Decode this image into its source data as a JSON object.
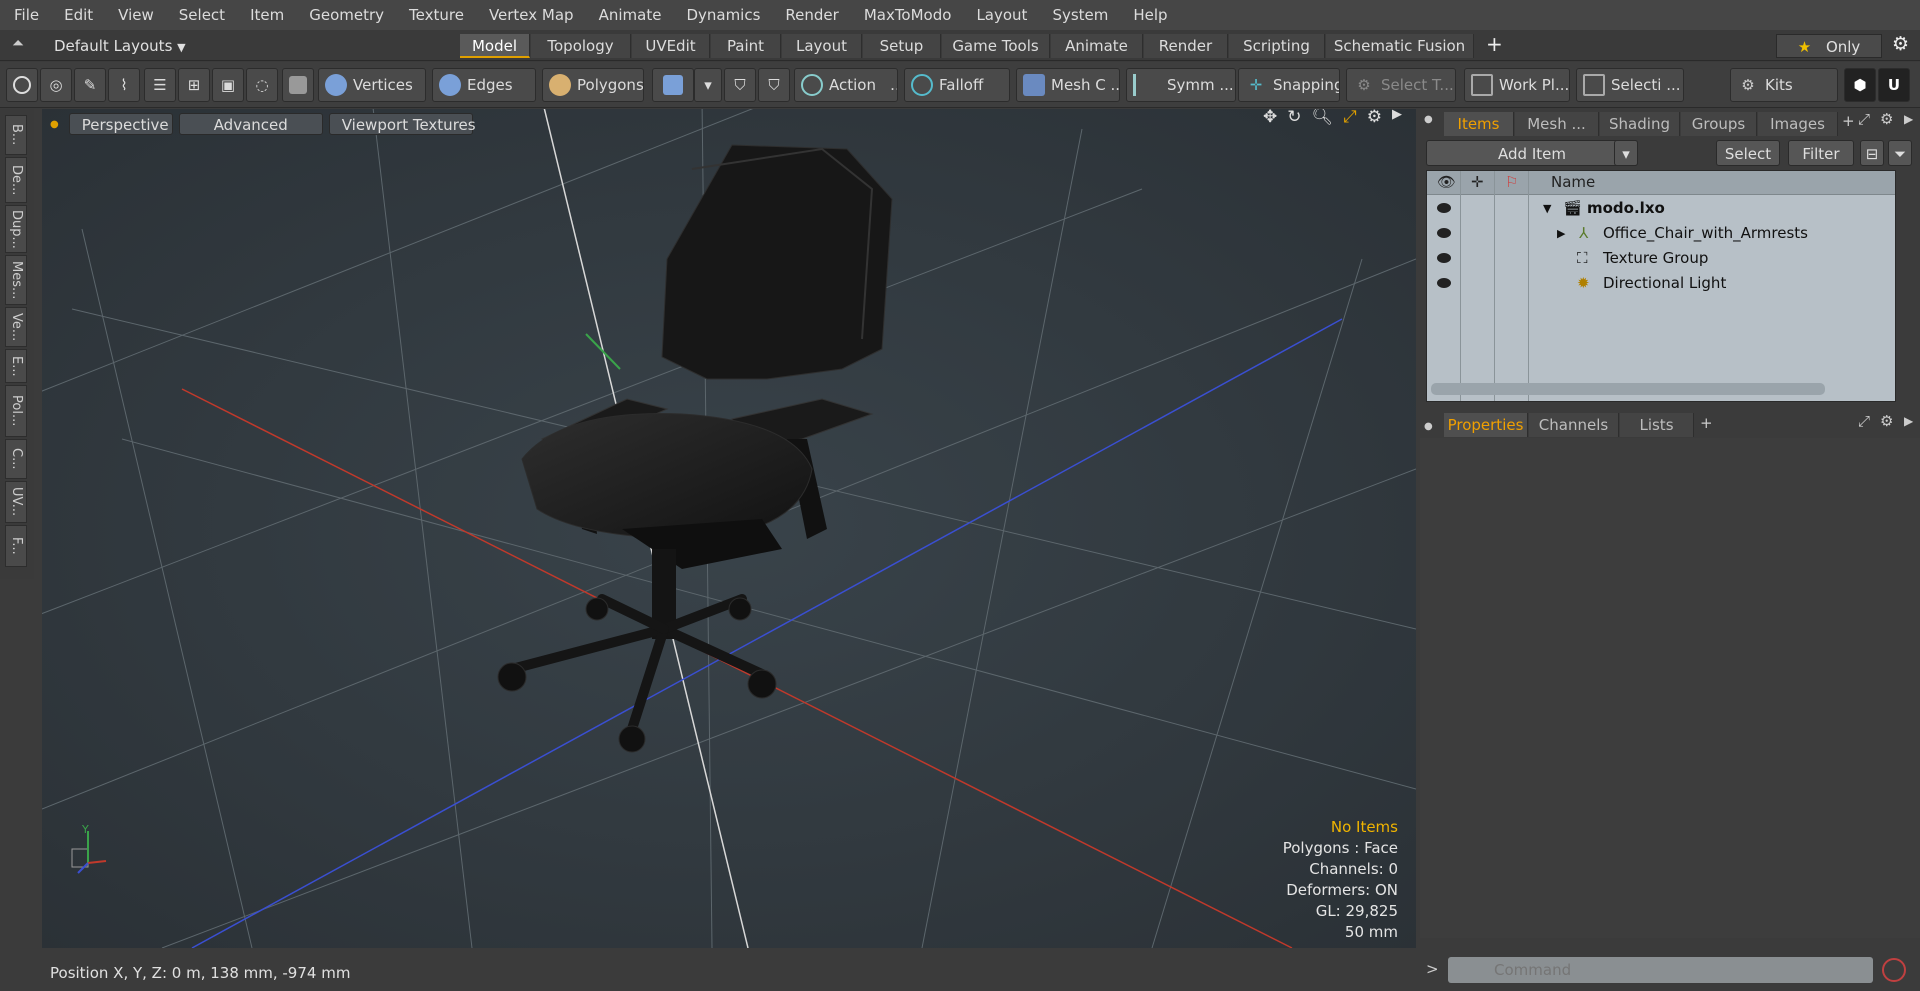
{
  "menu": [
    "File",
    "Edit",
    "View",
    "Select",
    "Item",
    "Geometry",
    "Texture",
    "Vertex Map",
    "Animate",
    "Dynamics",
    "Render",
    "MaxToModo",
    "Layout",
    "System",
    "Help"
  ],
  "layouts": {
    "default_label": "Default Layouts",
    "tabs": [
      "Model",
      "Topology",
      "UVEdit",
      "Paint",
      "Layout",
      "Setup",
      "Game Tools",
      "Animate",
      "Render",
      "Scripting",
      "Schematic Fusion"
    ],
    "add": "+",
    "only_label": "Only"
  },
  "toolbar": {
    "vertices": "Vertices",
    "edges": "Edges",
    "polygons": "Polygons",
    "action": "Action",
    "falloff": "Falloff",
    "mesh": "Mesh C ...",
    "symm": "Symm ...",
    "snapping": "Snapping",
    "select_t": "Select T...",
    "workplane": "Work Pl...",
    "selecti": "Selecti ...",
    "kits": "Kits"
  },
  "left_tabs": [
    "B...",
    "De...",
    "Dup...",
    "Mes...",
    "Ve...",
    "E...",
    "Pol...",
    "C...",
    "UV...",
    "F..."
  ],
  "viewport": {
    "perspective": "Perspective",
    "advanced": "Advanced",
    "textures": "Viewport Textures",
    "info": {
      "no_items": "No Items",
      "polygons": "Polygons : Face",
      "channels": "Channels: 0",
      "deformers": "Deformers: ON",
      "gl": "GL: 29,825",
      "scale": "50 mm"
    },
    "axis_y": "Y"
  },
  "status": {
    "position": "Position X, Y, Z:   0 m, 138 mm, -974 mm"
  },
  "items_panel": {
    "tabs": [
      "Items",
      "Mesh ...",
      "Shading",
      "Groups",
      "Images"
    ],
    "add_item": "Add Item",
    "select": "Select",
    "filter": "Filter",
    "name_header": "Name",
    "rows": [
      {
        "name": "modo.lxo"
      },
      {
        "name": "Office_Chair_with_Armrests"
      },
      {
        "name": "Texture Group"
      },
      {
        "name": "Directional Light"
      }
    ]
  },
  "props_panel": {
    "tabs": [
      "Properties",
      "Channels",
      "Lists"
    ],
    "add": "+"
  },
  "command": {
    "placeholder": "Command"
  },
  "colors": {
    "accent": "#f0a000",
    "viewport_bg": "#2f363c",
    "x_axis": "#c0392b",
    "z_axis": "#3a4fd1"
  }
}
